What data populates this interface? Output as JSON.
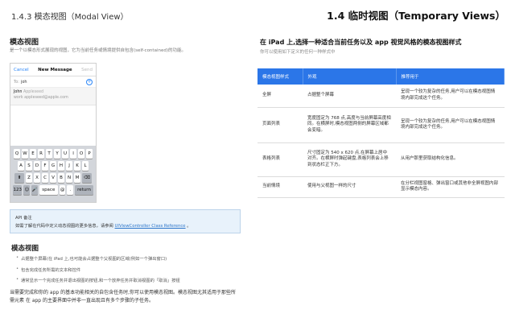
{
  "header": {
    "left": "1.4.3  模态视图（Modal View）",
    "right": "1.4  临时视图（Temporary Views）"
  },
  "left_section": {
    "title": "模态视图",
    "desc": "是一个以模态形式展现的视图，它为当前任务或情境提供自包含(self-contained)的功能。"
  },
  "phone": {
    "nav": {
      "cancel": "Cancel",
      "title": "New Message",
      "send": "Send"
    },
    "to_label": "To:",
    "to_value": "joh",
    "plus": "+",
    "suggestion": {
      "name": "John",
      "name_tag": "Appleseed",
      "email": "work  appleseed@apple.com"
    },
    "keyboard": {
      "row1": [
        "Q",
        "W",
        "E",
        "R",
        "T",
        "Y",
        "U",
        "I",
        "O",
        "P"
      ],
      "row2": [
        "A",
        "S",
        "D",
        "F",
        "G",
        "H",
        "J",
        "K",
        "L"
      ],
      "row3": [
        "Z",
        "X",
        "C",
        "V",
        "B",
        "N",
        "M"
      ],
      "shift": "⬆",
      "backspace": "⌫",
      "numbers": "123",
      "emoji": "☺",
      "mic": "🎤",
      "space": "space",
      "at": "@",
      "period": ".",
      "return": "return"
    }
  },
  "api_note": {
    "title": "API 备注",
    "text": "如需了解在代码中定义动态视图的更多信息，请参阅",
    "link": "UIViewController Class Reference",
    "suffix": "。"
  },
  "modal_section": {
    "title": "模态视图",
    "bullets": [
      "占据整个屏幕(在 iPad 上,也可能会占据整个父视图的区域(例如一个弹出窗口)",
      "包含完成任务所需的文本和控件",
      "通常显示一个完成任务并退出视图的按钮,和一个放弃任务并取消视图的「取消」按钮"
    ],
    "summary": "当需要完成和你的 app 的基本功能相关的自包含任务时,你可以使用模态视图。模态视图尤其适用于那些所需元素 在 app 的主要界面中并非一直出现且有多个步骤的子任务。"
  },
  "right_section": {
    "title": "在 iPad 上,选择一种适合当前任务以及 app 视觉风格的模态视图样式",
    "subtitle": "你可以使用如下定义的任何一种样式中",
    "table": {
      "headers": [
        "模态视图样式",
        "外观",
        "推荐用于"
      ],
      "rows": [
        {
          "style": "全屏",
          "appearance": "占据整个屏幕",
          "recommended": "呈现一个较为复杂的任务,用户可以在模态视图情境内部完成这个任务。"
        },
        {
          "style": "页面列表",
          "appearance": "宽度固定为 768 点,高度与当前屏幕高度相同。在横屏时,模态视图两侧的屏幕区域都会变暗。",
          "recommended": "呈现一个较为复杂的任务,用户可以在模态视图情境内部完成这个任务。"
        },
        {
          "style": "表格列表",
          "appearance": "尺寸固定为 540 x 620 点,在屏幕上居中对齐。在横屏时弹起键盘,表格列表会上移到状态栏正下方。",
          "recommended": "从用户那里获取结构化信息。"
        },
        {
          "style": "当前情境",
          "appearance": "使用与父视图一样的尺寸",
          "recommended": "在分栏视图窗格、弹出窗口或其他非全屏视图内部显示模态内容。"
        }
      ]
    }
  }
}
